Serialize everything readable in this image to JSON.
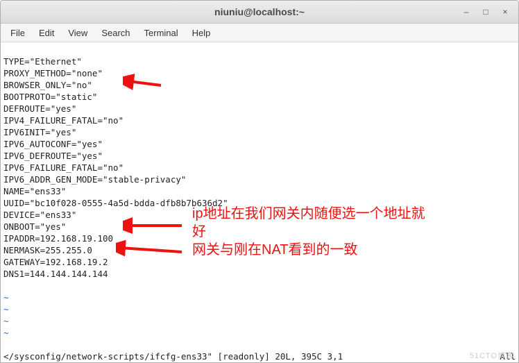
{
  "window": {
    "title": "niuniu@localhost:~",
    "buttons": {
      "minimize": "–",
      "maximize": "□",
      "close": "×"
    }
  },
  "menubar": {
    "file": "File",
    "edit": "Edit",
    "view": "View",
    "search": "Search",
    "terminal": "Terminal",
    "help": "Help"
  },
  "file_lines": [
    "TYPE=\"Ethernet\"",
    "PROXY_METHOD=\"none\"",
    "BROWSER_ONLY=\"no\"",
    "BOOTPROTO=\"static\"",
    "DEFROUTE=\"yes\"",
    "IPV4_FAILURE_FATAL=\"no\"",
    "IPV6INIT=\"yes\"",
    "IPV6_AUTOCONF=\"yes\"",
    "IPV6_DEFROUTE=\"yes\"",
    "IPV6_FAILURE_FATAL=\"no\"",
    "IPV6_ADDR_GEN_MODE=\"stable-privacy\"",
    "NAME=\"ens33\"",
    "UUID=\"bc10f028-0555-4a5d-bdda-dfb8b7b636d2\"",
    "DEVICE=\"ens33\"",
    "ONBOOT=\"yes\"",
    "IPADDR=192.168.19.100",
    "NERMASK=255.255.0",
    "GATEWAY=192.168.19.2",
    "DNS1=144.144.144.144"
  ],
  "tilde": "~",
  "status": {
    "left": "</sysconfig/network-scripts/ifcfg-ens33\" [readonly] 20L, 395C 3,1",
    "right": "All"
  },
  "annotations": {
    "ip_line1": "ip地址在我们网关内随便选一个地址就",
    "ip_line2": "好",
    "gateway": "网关与刚在NAT看到的一致"
  },
  "watermark": "51CTO博客"
}
